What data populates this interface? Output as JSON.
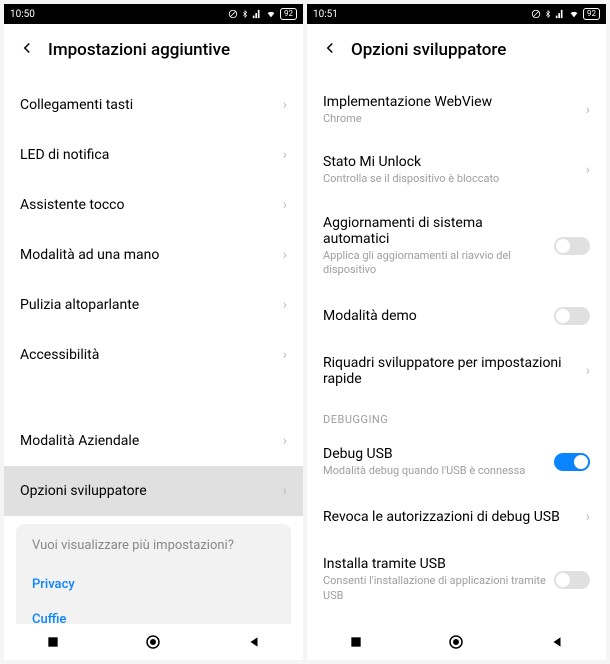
{
  "left": {
    "status": {
      "time": "10:50",
      "battery": "92"
    },
    "header": {
      "title": "Impostazioni aggiuntive"
    },
    "rows": {
      "r0": "Collegamenti tasti",
      "r1": "LED di notifica",
      "r2": "Assistente tocco",
      "r3": "Modalità ad una mano",
      "r4": "Pulizia altoparlante",
      "r5": "Accessibilità",
      "r6": "Modalità Aziendale",
      "r7": "Opzioni sviluppatore"
    },
    "more": {
      "title": "Vuoi visualizzare più impostazioni?",
      "privacy": "Privacy",
      "cuffie": "Cuffie"
    }
  },
  "right": {
    "status": {
      "time": "10:51",
      "battery": "92"
    },
    "header": {
      "title": "Opzioni sviluppatore"
    },
    "rows": {
      "webview": {
        "label": "Implementazione WebView",
        "sub": "Chrome"
      },
      "miunlock": {
        "label": "Stato Mi Unlock",
        "sub": "Controlla se il dispositivo è bloccato"
      },
      "autoupd": {
        "label": "Aggiornamenti di sistema automatici",
        "sub": "Applica gli aggiornamenti al riavvio del dispositivo"
      },
      "demo": {
        "label": "Modalità demo"
      },
      "devtiles": {
        "label": "Riquadri sviluppatore per impostazioni rapide"
      },
      "section": "DEBUGGING",
      "debugusb": {
        "label": "Debug USB",
        "sub": "Modalità debug quando l'USB è connessa"
      },
      "revoke": {
        "label": "Revoca le autorizzazioni di debug USB"
      },
      "installusb": {
        "label": "Installa tramite USB",
        "sub": "Consenti l'installazione di applicazioni tramite USB"
      }
    }
  }
}
